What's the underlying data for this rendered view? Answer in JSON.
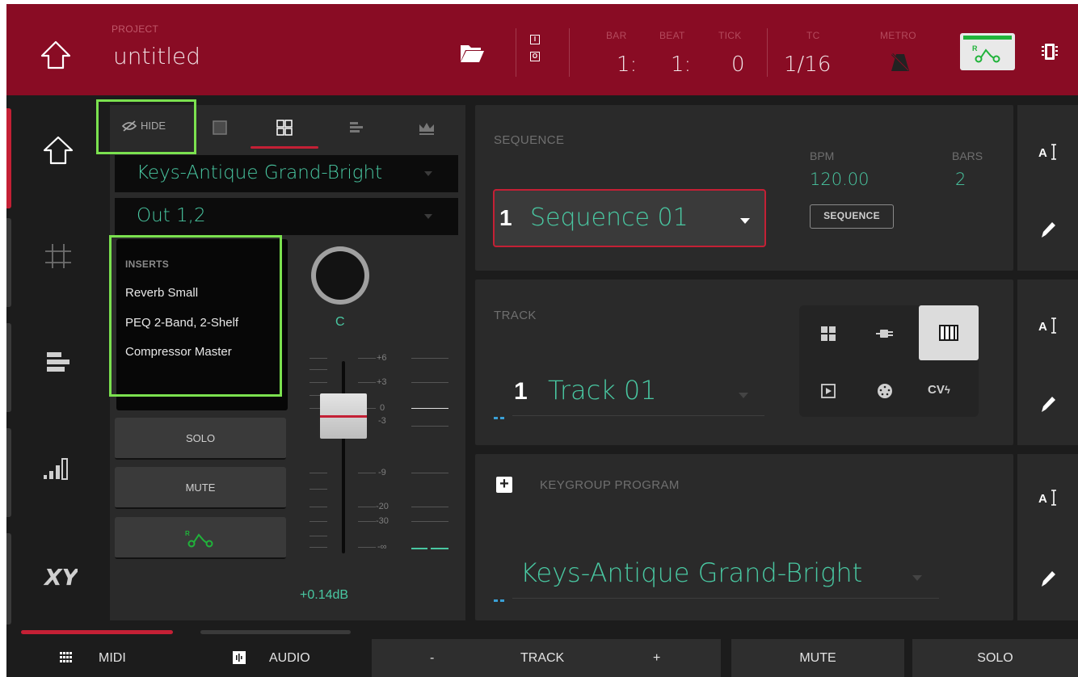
{
  "header": {
    "project_label": "PROJECT",
    "project_name": "untitled",
    "io_top": "I",
    "io_bottom": "O",
    "counters": [
      {
        "label": "BAR",
        "value": "1:"
      },
      {
        "label": "BEAT",
        "value": "1:"
      },
      {
        "label": "TICK",
        "value": "0"
      },
      {
        "label": "TC",
        "value": "1/16"
      },
      {
        "label": "METRO",
        "value": ""
      }
    ]
  },
  "channel_strip": {
    "hide_label": "HIDE",
    "program_select": "Keys-Antique Grand-Bright",
    "output_select": "Out 1,2",
    "inserts_title": "INSERTS",
    "inserts": [
      "Reverb Small",
      "PEQ 2-Band, 2-Shelf",
      "Compressor Master"
    ],
    "solo_label": "SOLO",
    "mute_label": "MUTE",
    "pan_value": "C",
    "db_scale": [
      "+6",
      "+3",
      "0",
      "-3",
      "-9",
      "-20",
      "-30",
      "-∞"
    ],
    "gain_value": "+0.14dB"
  },
  "sequence": {
    "label": "SEQUENCE",
    "bpm_label": "BPM",
    "bpm_value": "120.00",
    "bars_label": "BARS",
    "bars_value": "2",
    "number": "1",
    "name": "Sequence 01",
    "button_label": "SEQUENCE"
  },
  "track": {
    "label": "TRACK",
    "number": "1",
    "name": "Track 01",
    "cv_label": "CV"
  },
  "program": {
    "label": "KEYGROUP PROGRAM",
    "plus": "+",
    "name": "Keys-Antique Grand-Bright"
  },
  "footer": {
    "midi": "MIDI",
    "audio": "AUDIO",
    "minus": "-",
    "track": "TRACK",
    "plus": "+",
    "mute": "MUTE",
    "solo": "SOLO"
  },
  "colors": {
    "header_bg": "#890c24",
    "accent_red": "#c42035",
    "teal_value": "#49c8a2",
    "highlight_green": "#7be14f"
  }
}
